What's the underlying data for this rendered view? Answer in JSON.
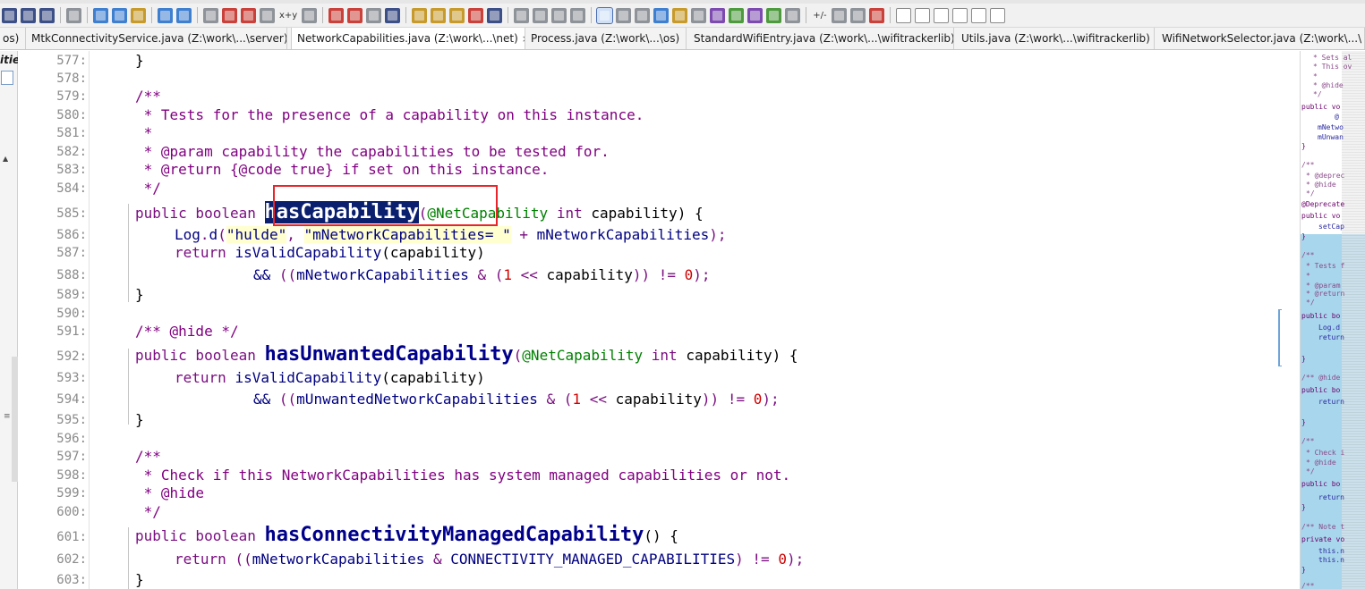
{
  "toolbar": {
    "glyphs": {
      "xy": "x+y",
      "plus_minus": "+/-"
    }
  },
  "tabs": [
    {
      "label": "os)",
      "active": false
    },
    {
      "label": "MtkConnectivityService.java (Z:\\work\\...\\server)",
      "active": false
    },
    {
      "label": "NetworkCapabilities.java (Z:\\work\\...\\net)",
      "active": true,
      "close": "×"
    },
    {
      "label": "Process.java (Z:\\work\\...\\os)",
      "active": false
    },
    {
      "label": "StandardWifiEntry.java (Z:\\work\\...\\wifitrackerlib)",
      "active": false
    },
    {
      "label": "Utils.java (Z:\\work\\...\\wifitrackerlib)",
      "active": false
    },
    {
      "label": "WifiNetworkSelector.java (Z:\\work\\...\\",
      "active": false
    }
  ],
  "left_panel": {
    "label": "itie"
  },
  "line_numbers": [
    "577:",
    "578:",
    "579:",
    "580:",
    "581:",
    "582:",
    "583:",
    "584:",
    "585:",
    "586:",
    "587:",
    "588:",
    "589:",
    "590:",
    "591:",
    "592:",
    "593:",
    "594:",
    "595:",
    "596:",
    "597:",
    "598:",
    "599:",
    "600:",
    "601:",
    "602:",
    "603:"
  ],
  "code": {
    "l577": {
      "brace": "}"
    },
    "l579": {
      "text": "/**"
    },
    "l580": {
      "text": " * Tests for the presence of a capability on this instance."
    },
    "l581": {
      "text": " *"
    },
    "l582": {
      "text": " * @param capability the capabilities to be tested for."
    },
    "l583": {
      "text": " * @return {@code true} if set on this instance."
    },
    "l584": {
      "text": " */"
    },
    "l585": {
      "mods": "public boolean ",
      "name": "hasCapability",
      "annot": "@NetCapability",
      "ptype": " int ",
      "pname": "capability",
      "tail": ") {"
    },
    "l586": {
      "obj": "Log",
      "dot": ".",
      "method": "d",
      "p1": "(",
      "s1": "\"hulde\"",
      "comma": ", ",
      "s2": "\"mNetworkCapabilities= \"",
      "plus": " + ",
      "var": "mNetworkCapabilities",
      "end": ");"
    },
    "l587": {
      "ret": "return ",
      "call": "isValidCapability",
      "args": "(capability)"
    },
    "l588": {
      "op": "&& ",
      "p": "((",
      "var": "mNetworkCapabilities",
      "mid": " & (",
      "one": "1",
      "shift": " << ",
      "cap": "capability",
      "close": ")) != ",
      "zero": "0",
      "end": ");"
    },
    "l589": {
      "brace": "}"
    },
    "l591": {
      "text": "/** @hide */"
    },
    "l592": {
      "mods": "public boolean ",
      "name": "hasUnwantedCapability",
      "annot": "@NetCapability",
      "ptype": " int ",
      "pname": "capability",
      "tail": ") {"
    },
    "l593": {
      "ret": "return ",
      "call": "isValidCapability",
      "args": "(capability)"
    },
    "l594": {
      "op": "&& ",
      "p": "((",
      "var": "mUnwantedNetworkCapabilities",
      "mid": " & (",
      "one": "1",
      "shift": " << ",
      "cap": "capability",
      "close": ")) != ",
      "zero": "0",
      "end": ");"
    },
    "l595": {
      "brace": "}"
    },
    "l597": {
      "text": "/**"
    },
    "l598": {
      "text": " * Check if this NetworkCapabilities has system managed capabilities or not."
    },
    "l599": {
      "text": " * @hide"
    },
    "l600": {
      "text": " */"
    },
    "l601": {
      "mods": "public boolean ",
      "name": "hasConnectivityManagedCapability",
      "tail": "() {"
    },
    "l602": {
      "ret": "return ",
      "p": "((",
      "var": "mNetworkCapabilities",
      "mid": " & ",
      "const": "CONNECTIVITY_MANAGED_CAPABILITIES",
      "close": ") != ",
      "zero": "0",
      "end": ");"
    },
    "l603": {
      "brace": "}"
    }
  },
  "minimap": [
    "* Sets al",
    "* This ov",
    "*",
    "* @hide",
    "*/",
    "public vo",
    "@",
    "mNetwo",
    "mUnwan",
    "}",
    "/**",
    "* @deprec",
    "* @hide",
    "*/",
    "@Deprecate",
    "public vo",
    "setCap",
    "}",
    "/**",
    "* Tests f",
    "*",
    "* @param",
    "* @return",
    "*/",
    "public bo",
    "Log.d",
    "return",
    "}",
    "/** @hide",
    "public bo",
    "return",
    "}",
    "/**",
    "* Check i",
    "* @hide",
    "*/",
    "public bo",
    "return",
    "}",
    "/** Note t",
    "private vo",
    "this.n",
    "this.n",
    "}",
    "/**"
  ]
}
